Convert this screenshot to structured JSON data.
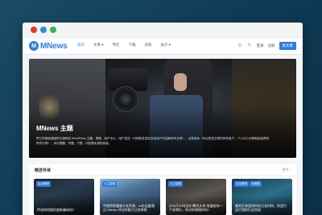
{
  "window": {
    "controls": [
      "close",
      "minimize",
      "maximize"
    ]
  },
  "site": {
    "logo_mark": "M",
    "logo_text": "MNews",
    "nav": [
      {
        "label": "首页",
        "active": true
      },
      {
        "label": "文章 ▾"
      },
      {
        "label": "专栏"
      },
      {
        "label": "下载"
      },
      {
        "label": "问答"
      },
      {
        "label": "关于 ▾"
      }
    ],
    "tools": {
      "login": "登录",
      "register": "注册",
      "post": "发文章"
    }
  },
  "hero": {
    "title": "MNews 主题",
    "desc": "梦兰同城家居团购汉语网站 WordPress 主题。博物、用户中心、用户发送（可获取发送在自动用户内容和所有文章）、点赞连动（可点赞送文章的所有用户，个人中心可获取到连赞的所有文章）、评论提醒、专题、下载、问答等实用的功能。"
  },
  "featured": {
    "title": "精选导读",
    "more": "更多 ›",
    "cards": [
      {
        "tags": [
          "企业服务"
        ],
        "caption": "传说的挖掘机变新漏电吗?"
      },
      {
        "tags": [
          "人工智能"
        ],
        "caption": "中国首款重量头发资源，AI在运量通过 GitHub 评估的能力已经惊艳"
      },
      {
        "tags": [
          "人工智能"
        ],
        "caption": "什么什么叫法在“腾讯头条”发展给你一个非常价，你对的理理的吗?"
      },
      {
        "tags": [
          "企业服务",
          "大数据"
        ],
        "caption": "看的天来直线科技日长时间，你会行这打墙的打这完成"
      }
    ]
  },
  "colors": {
    "accent": "#2e7de0",
    "page_bg": "#0f3a55"
  }
}
